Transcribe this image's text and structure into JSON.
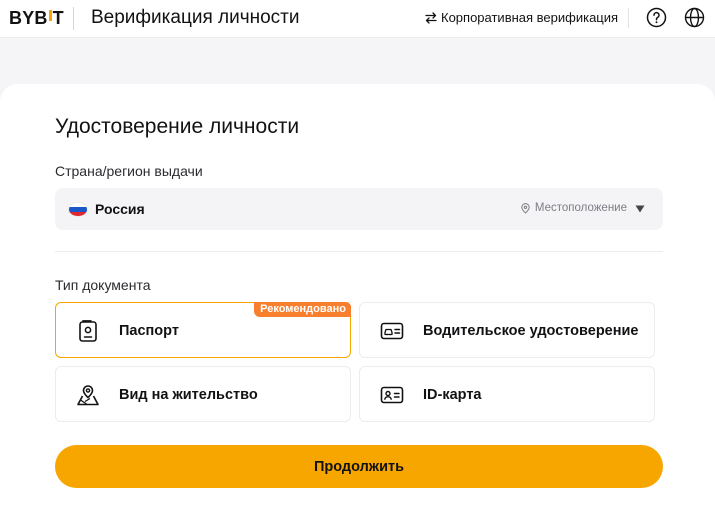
{
  "header": {
    "logo_left": "BYB",
    "logo_right": "T",
    "title": "Верификация личности",
    "corporate_link": "Корпоративная верификация",
    "help_icon": "question-circle-icon",
    "language_icon": "globe-icon"
  },
  "form": {
    "title": "Удостоверение личности",
    "country_label": "Страна/регион выдачи",
    "country_value": "Россия",
    "country_flag": [
      "#ffffff",
      "#1c57c8",
      "#e0262e"
    ],
    "location_label": "Местоположение",
    "doc_type_label": "Тип документа",
    "documents": [
      {
        "label": "Паспорт",
        "icon": "passport-icon",
        "selected": true,
        "badge": "Рекомендовано"
      },
      {
        "label": "Водительское удостоверение",
        "icon": "driver-license-icon",
        "selected": false
      },
      {
        "label": "Вид на жительство",
        "icon": "residence-permit-icon",
        "selected": false
      },
      {
        "label": "ID-карта",
        "icon": "id-card-icon",
        "selected": false
      }
    ],
    "continue_label": "Продолжить"
  },
  "colors": {
    "accent": "#f7a600",
    "badge": "#f77f2e",
    "input_bg": "#f4f4f6",
    "page_bg": "#f5f5f7"
  }
}
